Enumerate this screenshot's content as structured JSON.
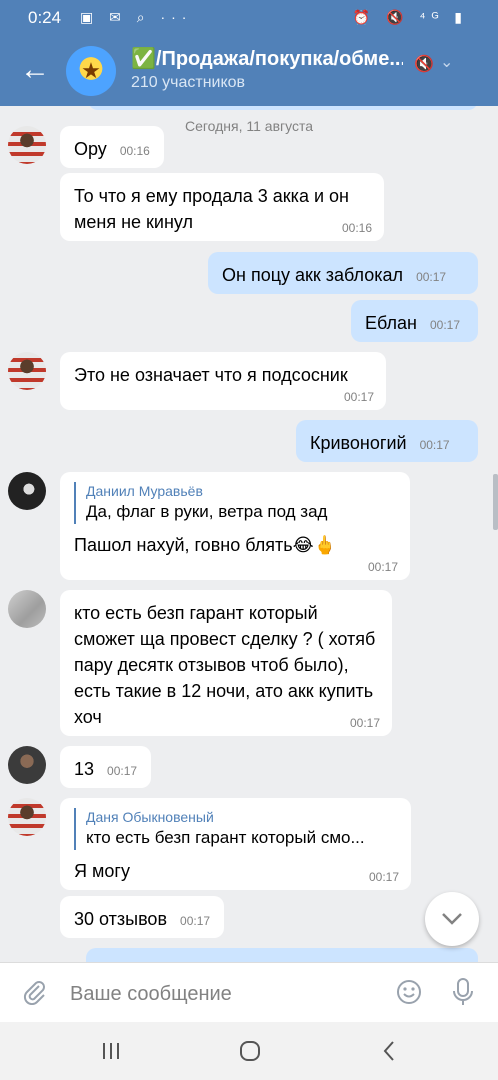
{
  "status_bar": {
    "time": "0:24",
    "left_icons": "▣ ✉ ⌕ ···",
    "right_icons": "⏰ 🔇 ⁴ᴳ ▮"
  },
  "header": {
    "title": "✅/Продажа/покупка/обме...",
    "subtitle": "210 участников"
  },
  "date_separator": "Сегодня, 11 августа",
  "messages": [
    {
      "text": "Ору",
      "time": "00:16"
    },
    {
      "text": "То что я ему продала 3 акка и он меня не кинул",
      "time": "00:16"
    },
    {
      "text": "Он поцу акк заблокал",
      "time": "00:17"
    },
    {
      "text": "Еблан",
      "time": "00:17"
    },
    {
      "text": "Это не означает что я подсосник",
      "time": "00:17"
    },
    {
      "text": "Кривоногий",
      "time": "00:17"
    },
    {
      "reply_name": "Даниил Муравьёв",
      "reply_text": "Да, флаг в руки, ветра под зад",
      "text": "Пашол нахуй, говно блять😂🖕",
      "time": "00:17"
    },
    {
      "text": "кто есть безп гарант который сможет ща провест сделку ? ( хотяб пару десятк отзывов чтоб было), есть такие в 12 ночи, ато акк купить хоч",
      "time": "00:17"
    },
    {
      "text": "13",
      "time": "00:17"
    },
    {
      "reply_name": "Даня Обыкновеный",
      "reply_text": "кто есть безп гарант который смо...",
      "text": "Я могу",
      "time": "00:17"
    },
    {
      "text": "30 отзывов",
      "time": "00:17"
    }
  ],
  "composer": {
    "placeholder": "Ваше сообщение"
  },
  "icons": {
    "back": "arrow-left-icon",
    "mute": "muted-icon",
    "scroll_down": "chevron-down-icon",
    "attach": "paperclip-icon",
    "emoji": "smile-icon",
    "mic": "microphone-icon",
    "nav_recents": "recents-icon",
    "nav_home": "home-icon",
    "nav_back": "back-icon"
  },
  "colors": {
    "header": "#5181b8",
    "background": "#edeef0",
    "incoming": "#ffffff",
    "outgoing": "#cce4ff",
    "accent": "#5181b8",
    "time": "#828282"
  }
}
